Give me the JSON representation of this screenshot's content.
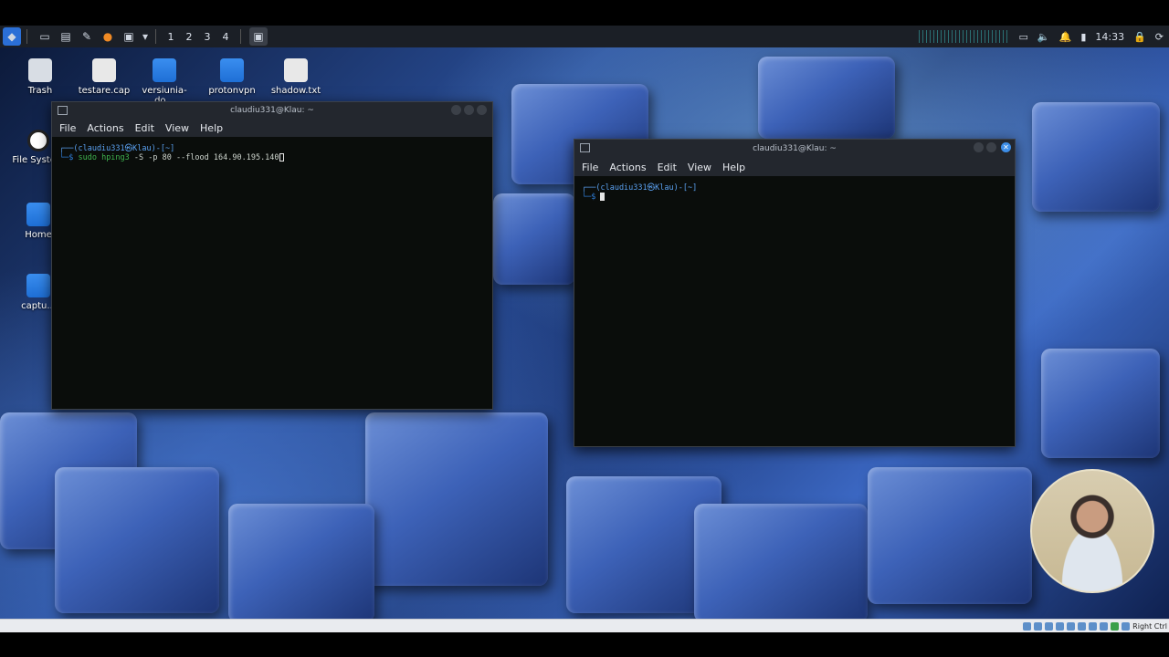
{
  "top_panel": {
    "workspaces": [
      "1",
      "2",
      "3",
      "4"
    ],
    "clock": "14:33"
  },
  "desktop_icons": [
    {
      "label": "Trash",
      "type": "trash"
    },
    {
      "label": "testare.cap",
      "type": "file"
    },
    {
      "label": "versiunia-do...",
      "type": "folder"
    },
    {
      "label": "protonvpn",
      "type": "folder"
    },
    {
      "label": "shadow.txt",
      "type": "file"
    },
    {
      "label": "File System",
      "type": "drive"
    },
    {
      "label": "Home",
      "type": "folder"
    },
    {
      "label": "captu...",
      "type": "folder"
    }
  ],
  "terminal_left": {
    "title": "claudiu331@Klau: ~",
    "menu": [
      "File",
      "Actions",
      "Edit",
      "View",
      "Help"
    ],
    "prompt_line": "┌──(claudiu331㉿Klau)-[~]",
    "prompt_symbol": "└─$",
    "command_kw": "sudo hping3",
    "command_rest": " -S -p 80 --flood 164.90.195.140"
  },
  "terminal_right": {
    "title": "claudiu331@Klau: ~",
    "menu": [
      "File",
      "Actions",
      "Edit",
      "View",
      "Help"
    ],
    "prompt_line": "┌──(claudiu331㉿Klau)-[~]",
    "prompt_symbol": "└─$"
  },
  "host_bar": {
    "label": "Right Ctrl"
  }
}
